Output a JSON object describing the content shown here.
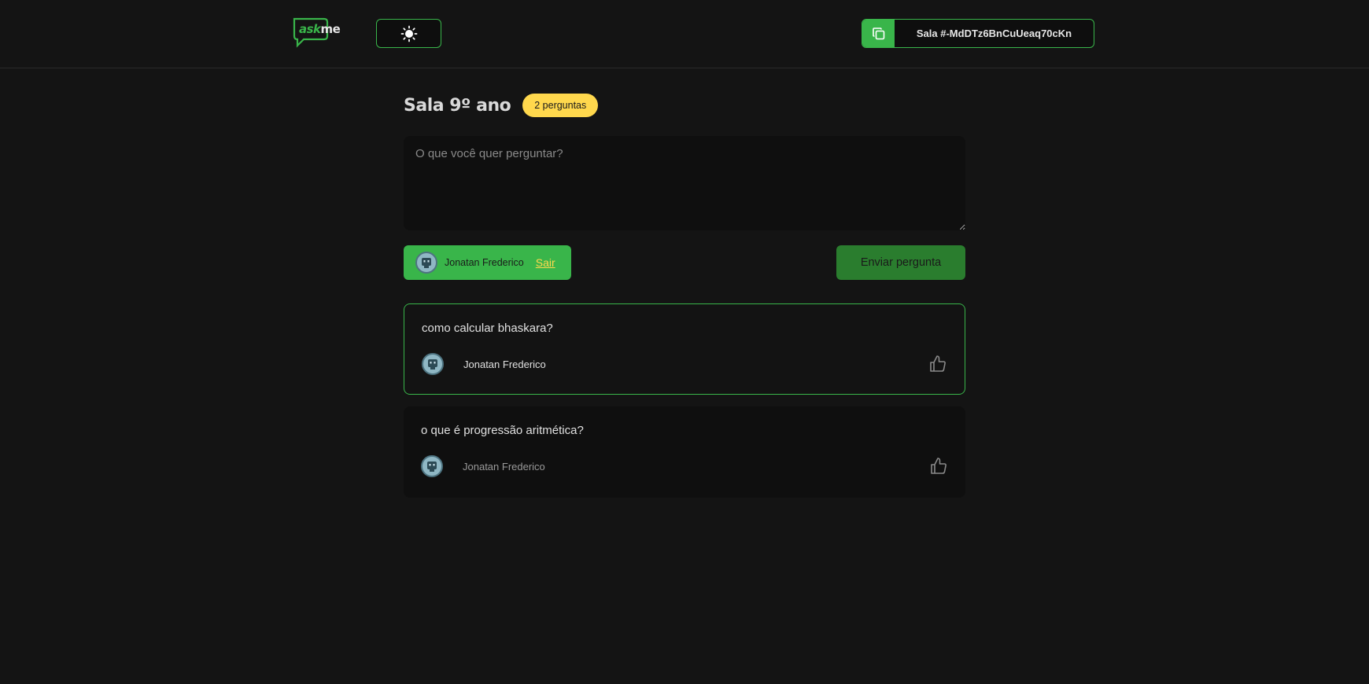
{
  "header": {
    "logo": {
      "ask": "ask",
      "me": "me"
    },
    "theme_toggle_icon": "sun-icon",
    "room_code": "Sala #-MdDTz6BnCuUeaq70cKn",
    "copy_icon": "copy-icon"
  },
  "room": {
    "title": "Sala 9º ano",
    "question_count": "2 perguntas"
  },
  "form": {
    "placeholder": "O que você quer perguntar?",
    "user_name": "Jonatan Frederico",
    "logout_label": "Sair",
    "send_label": "Enviar pergunta"
  },
  "questions": [
    {
      "text": "como calcular bhaskara?",
      "author": "Jonatan Frederico",
      "highlighted": true
    },
    {
      "text": "o que é progressão aritmética?",
      "author": "Jonatan Frederico",
      "highlighted": false
    }
  ],
  "colors": {
    "accent": "#39b54a",
    "badge": "#ffd84d",
    "background": "#141414"
  }
}
